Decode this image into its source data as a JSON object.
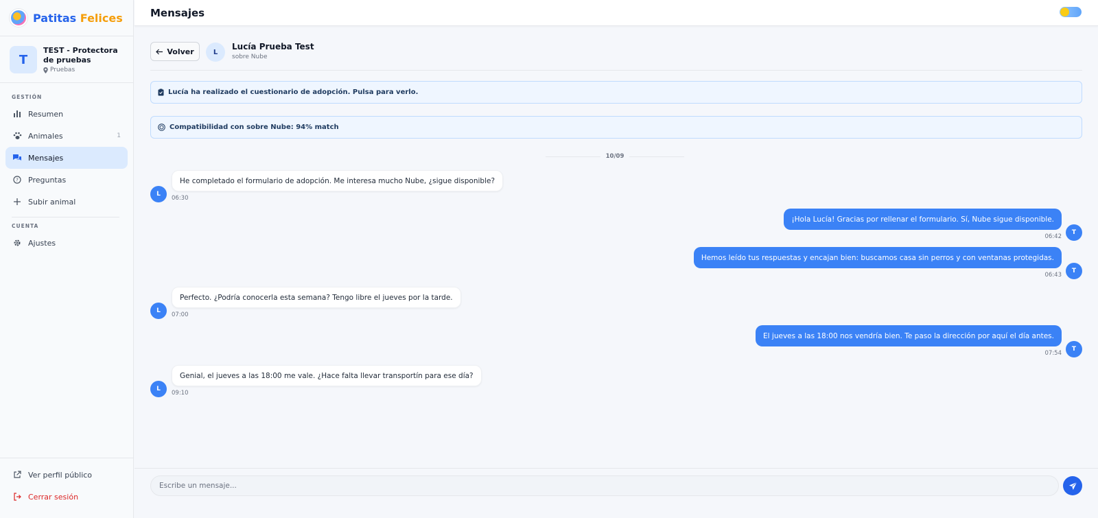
{
  "brand": {
    "name_part1": "Patitas",
    "name_part2": "Felices"
  },
  "org": {
    "initial": "T",
    "name": "TEST - Protectora de pruebas",
    "location": "Pruebas"
  },
  "nav": {
    "section_manage": "GESTIÓN",
    "items": [
      {
        "label": "Resumen",
        "icon": "bar-chart-icon"
      },
      {
        "label": "Animales",
        "icon": "paw-icon",
        "badge": "1"
      },
      {
        "label": "Mensajes",
        "icon": "chat-icon",
        "active": true
      },
      {
        "label": "Preguntas",
        "icon": "question-icon"
      },
      {
        "label": "Subir animal",
        "icon": "plus-icon"
      }
    ],
    "section_account": "CUENTA",
    "settings": "Ajustes",
    "public_profile": "Ver perfil público",
    "logout": "Cerrar sesión"
  },
  "topbar": {
    "title": "Mensajes"
  },
  "chat": {
    "back_label": "Volver",
    "contact_initial": "L",
    "contact_name": "Lucía Prueba Test",
    "contact_subtitle": "sobre Nube",
    "notice_questionnaire": "Lucía ha realizado el cuestionario de adopción. Pulsa para verlo.",
    "notice_compat": "Compatibilidad con sobre Nube: 94% match",
    "date_separator": "10/09",
    "messages": [
      {
        "from": "in",
        "avatar": "L",
        "text": "He completado el formulario de adopción. Me interesa mucho Nube, ¿sigue disponible?",
        "time": "06:30"
      },
      {
        "from": "out",
        "avatar": "T",
        "text": "¡Hola Lucía! Gracias por rellenar el formulario. Sí, Nube sigue disponible.",
        "time": "06:42"
      },
      {
        "from": "out",
        "avatar": "T",
        "text": "Hemos leído tus respuestas y encajan bien: buscamos casa sin perros y con ventanas protegidas.",
        "time": "06:43"
      },
      {
        "from": "in",
        "avatar": "L",
        "text": "Perfecto. ¿Podría conocerla esta semana? Tengo libre el jueves por la tarde.",
        "time": "07:00"
      },
      {
        "from": "out",
        "avatar": "T",
        "text": "El jueves a las 18:00 nos vendría bien. Te paso la dirección por aquí el día antes.",
        "time": "07:54"
      },
      {
        "from": "in",
        "avatar": "L",
        "text": "Genial, el jueves a las 18:00 me vale. ¿Hace falta llevar transportín para ese día?",
        "time": "09:10"
      }
    ],
    "input_placeholder": "Escribe un mensaje..."
  },
  "colors": {
    "accent": "#3b82f6",
    "brand_blue": "#2563eb",
    "brand_orange": "#f59e0b",
    "danger": "#dc2626"
  }
}
